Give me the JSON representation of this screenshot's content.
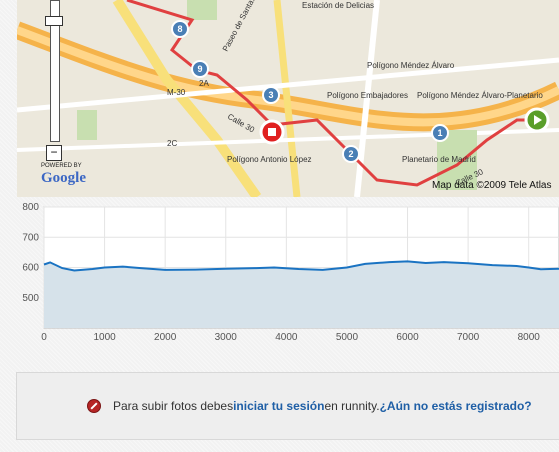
{
  "map": {
    "google_label": "Google",
    "powered_by": "POWERED BY",
    "data_credit": "Map data ©2009  Tele Atlas",
    "zoom_minus": "−",
    "streets": [
      {
        "label": "Paseo de Santa..."
      },
      {
        "label": "Estación de Delicias"
      },
      {
        "label": "M-30"
      },
      {
        "label": "Calle 30"
      },
      {
        "label": "Calle 30"
      },
      {
        "label": "Polígono Méndez Álvaro"
      },
      {
        "label": "Polígono Embajadores"
      },
      {
        "label": "Polígono Méndez Álvaro-Planetario"
      },
      {
        "label": "Polígono Antonio López"
      },
      {
        "label": "Planetario de Madrid"
      },
      {
        "label": "2A"
      },
      {
        "label": "2C"
      }
    ],
    "markers": [
      "8",
      "9",
      "3",
      "2",
      "1"
    ]
  },
  "elevation": {
    "y_ticks": [
      800,
      700,
      600,
      500
    ],
    "x_ticks": [
      0,
      1000,
      2000,
      3000,
      4000,
      5000,
      6000,
      7000,
      8000
    ],
    "ylim": [
      400,
      800
    ],
    "xlim": [
      0,
      8500
    ],
    "series": [
      {
        "x": 0,
        "y": 610
      },
      {
        "x": 100,
        "y": 617
      },
      {
        "x": 300,
        "y": 598
      },
      {
        "x": 500,
        "y": 590
      },
      {
        "x": 800,
        "y": 595
      },
      {
        "x": 1000,
        "y": 600
      },
      {
        "x": 1300,
        "y": 603
      },
      {
        "x": 1600,
        "y": 598
      },
      {
        "x": 2000,
        "y": 592
      },
      {
        "x": 2500,
        "y": 593
      },
      {
        "x": 3000,
        "y": 596
      },
      {
        "x": 3500,
        "y": 598
      },
      {
        "x": 3800,
        "y": 600
      },
      {
        "x": 4200,
        "y": 595
      },
      {
        "x": 4600,
        "y": 592
      },
      {
        "x": 5000,
        "y": 600
      },
      {
        "x": 5300,
        "y": 612
      },
      {
        "x": 5700,
        "y": 618
      },
      {
        "x": 6000,
        "y": 620
      },
      {
        "x": 6300,
        "y": 615
      },
      {
        "x": 6600,
        "y": 618
      },
      {
        "x": 7000,
        "y": 614
      },
      {
        "x": 7400,
        "y": 608
      },
      {
        "x": 7800,
        "y": 605
      },
      {
        "x": 8000,
        "y": 600
      },
      {
        "x": 8200,
        "y": 594
      },
      {
        "x": 8500,
        "y": 596
      }
    ]
  },
  "notice": {
    "text_before": "Para subir fotos debes ",
    "login_link": "iniciar tu sesión",
    "text_middle": " en runnity. ",
    "register_link": "¿Aún no estás registrado?"
  }
}
